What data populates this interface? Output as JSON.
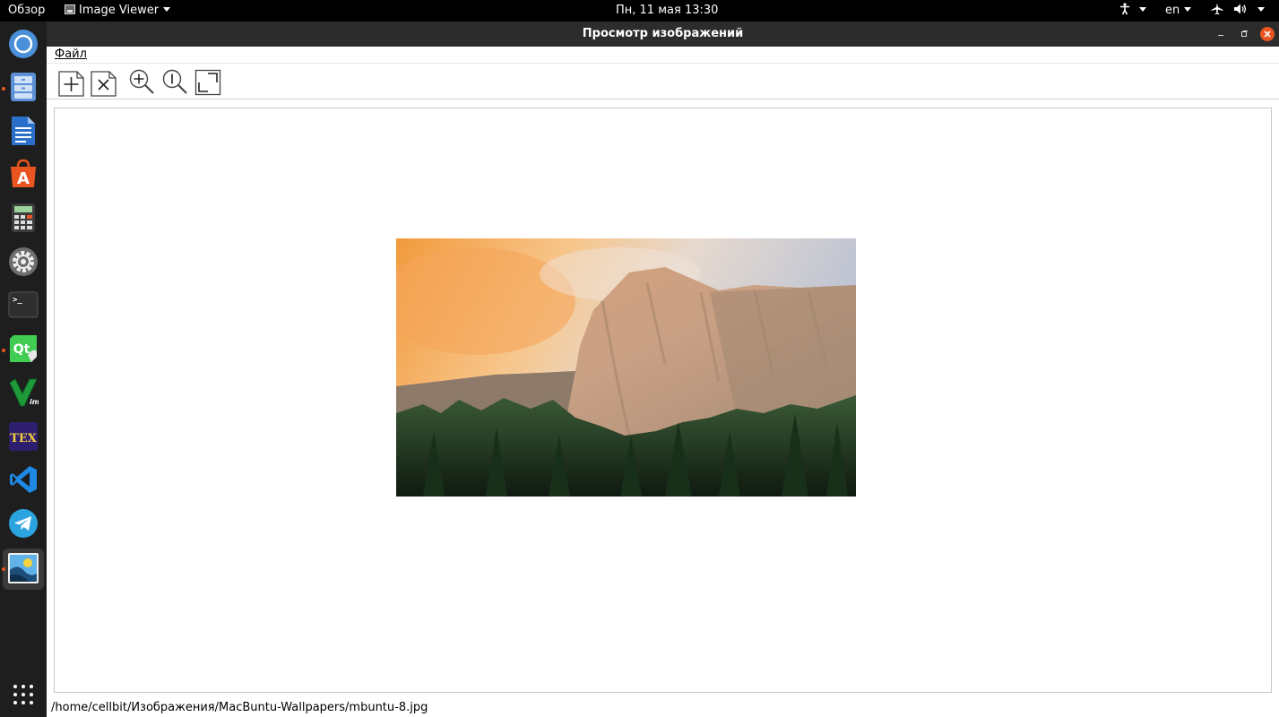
{
  "topbar": {
    "activities": "Обзор",
    "app_menu": "Image Viewer",
    "clock": "Пн, 11 мая  13:30",
    "lang": "en"
  },
  "dock": {
    "items": [
      {
        "name": "chromium",
        "icon": "chrome-icon",
        "color": "#4a90d9"
      },
      {
        "name": "files",
        "icon": "files-icon",
        "color": "#5b8fd6"
      },
      {
        "name": "writer",
        "icon": "writer-icon",
        "color": "#2a6fc9"
      },
      {
        "name": "software",
        "icon": "software-store-icon",
        "color": "#e95420"
      },
      {
        "name": "calculator",
        "icon": "calculator-icon",
        "color": "#555555"
      },
      {
        "name": "settings",
        "icon": "settings-icon",
        "color": "#777777"
      },
      {
        "name": "terminal",
        "icon": "terminal-icon",
        "color": "#333333"
      },
      {
        "name": "qtcreator",
        "icon": "qt-icon",
        "color": "#41cd52"
      },
      {
        "name": "vim",
        "icon": "vim-icon",
        "color": "#1f9a3a"
      },
      {
        "name": "texmaker",
        "icon": "tex-icon",
        "color": "#3b2a8a"
      },
      {
        "name": "vscode",
        "icon": "vscode-icon",
        "color": "#1e88e5"
      },
      {
        "name": "telegram",
        "icon": "telegram-icon",
        "color": "#2aa3df"
      },
      {
        "name": "image-viewer",
        "icon": "image-viewer-icon",
        "color": "#3b8ed0"
      }
    ],
    "show_apps_icon": "app-grid-icon"
  },
  "window": {
    "title": "Просмотр изображений",
    "menu": {
      "file": "Файл"
    },
    "toolbar": [
      {
        "name": "open",
        "icon": "new-file-icon"
      },
      {
        "name": "close",
        "icon": "close-file-icon"
      },
      {
        "name": "zoom-in",
        "icon": "zoom-in-icon"
      },
      {
        "name": "zoom-reset",
        "icon": "zoom-original-icon"
      },
      {
        "name": "fit",
        "icon": "fit-window-icon"
      }
    ],
    "status_path": "/home/cellbit/Изображения/MacBuntu-Wallpapers/mbuntu-8.jpg"
  },
  "colors": {
    "accent": "#e95420",
    "titlebar": "#2c2c2c",
    "dock": "#1e1e1e"
  }
}
